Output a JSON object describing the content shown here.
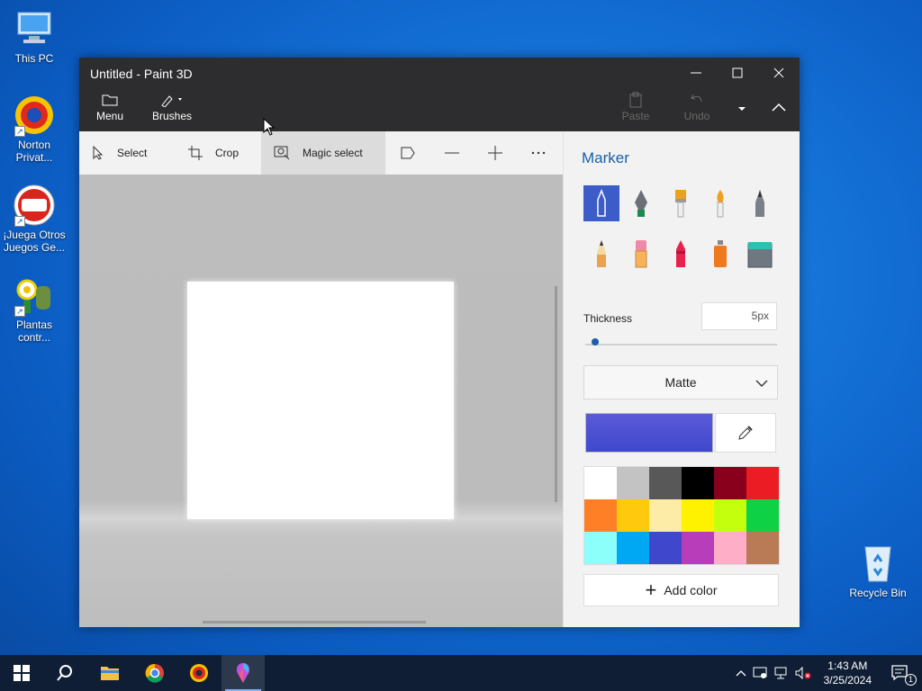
{
  "desktop": {
    "icons": [
      {
        "label": "This PC",
        "name": "this-pc"
      },
      {
        "label": "Norton Privat...",
        "name": "norton-private"
      },
      {
        "label": "¡Juega Otros Juegos Ge...",
        "name": "popcap-games"
      },
      {
        "label": "Plantas contr...",
        "name": "plantas-contra-zombies"
      },
      {
        "label": "Recycle Bin",
        "name": "recycle-bin"
      }
    ]
  },
  "window": {
    "title": "Untitled - Paint 3D",
    "ribbon": {
      "menu_label": "Menu",
      "brushes_label": "Brushes",
      "paste_label": "Paste",
      "undo_label": "Undo"
    },
    "toolbar": {
      "select_label": "Select",
      "crop_label": "Crop",
      "magic_select_label": "Magic select"
    },
    "panel": {
      "title": "Marker",
      "thickness_label": "Thickness",
      "thickness_value": "5px",
      "thickness_fraction": 0.05,
      "finish_value": "Matte",
      "current_color": "#3f48cc",
      "palette": [
        "#ffffff",
        "#c3c3c3",
        "#585858",
        "#000000",
        "#88001b",
        "#ec1c24",
        "#ff7f27",
        "#ffc90e",
        "#fdeca6",
        "#fff200",
        "#c4ff0e",
        "#0ed145",
        "#8cfffb",
        "#00a8f3",
        "#3f48cc",
        "#b83dba",
        "#ffaec8",
        "#b97a56"
      ],
      "add_color_label": "Add color"
    }
  },
  "taskbar": {
    "time": "1:43 AM",
    "date": "3/25/2024",
    "notification_count": "1"
  }
}
